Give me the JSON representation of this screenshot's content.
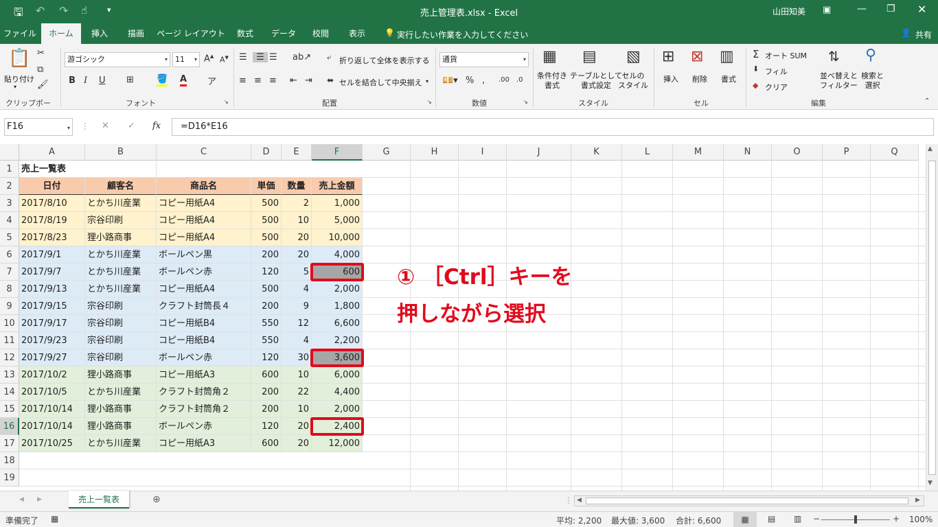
{
  "window": {
    "title": "売上管理表.xlsx - Excel",
    "user": "山田知美"
  },
  "tabs": [
    "ファイル",
    "ホーム",
    "挿入",
    "描画",
    "ページ レイアウト",
    "数式",
    "データ",
    "校閲",
    "表示"
  ],
  "tell_me": "実行したい作業を入力してください",
  "share": "共有",
  "ribbon": {
    "clipboard": {
      "paste": "貼り付け",
      "label": "クリップボード"
    },
    "font": {
      "name": "游ゴシック",
      "size": "11",
      "label": "フォント",
      "bold": "B",
      "italic": "I",
      "underline": "U"
    },
    "alignment": {
      "wrap": "折り返して全体を表示する",
      "merge": "セルを結合して中央揃え",
      "label": "配置"
    },
    "number": {
      "format": "通貨",
      "label": "数値"
    },
    "styles": {
      "cond": "条件付き\n書式",
      "table": "テーブルとして\n書式設定",
      "cell": "セルの\nスタイル",
      "label": "スタイル"
    },
    "cells": {
      "insert": "挿入",
      "delete": "削除",
      "format": "書式",
      "label": "セル"
    },
    "editing": {
      "autosum": "オート SUM",
      "fill": "フィル",
      "clear": "クリア",
      "sort": "並べ替えと\nフィルター",
      "find": "検索と\n選択",
      "label": "編集"
    }
  },
  "formula_bar": {
    "name_box": "F16",
    "fx": "fx",
    "formula": "=D16*E16"
  },
  "columns": [
    "A",
    "B",
    "C",
    "D",
    "E",
    "F",
    "G",
    "H",
    "I",
    "J",
    "K",
    "L",
    "M",
    "N",
    "O",
    "P",
    "Q"
  ],
  "rows": [
    "1",
    "2",
    "3",
    "4",
    "5",
    "6",
    "7",
    "8",
    "9",
    "10",
    "11",
    "12",
    "13",
    "14",
    "15",
    "16",
    "17",
    "18",
    "19"
  ],
  "sheet": {
    "title": "売上一覧表",
    "headers": [
      "日付",
      "顧客名",
      "商品名",
      "単価",
      "数量",
      "売上金額"
    ],
    "data": [
      [
        "2017/8/10",
        "とかち川産業",
        "コピー用紙A4",
        "500",
        "2",
        "1,000"
      ],
      [
        "2017/8/19",
        "宗谷印刷",
        "コピー用紙A4",
        "500",
        "10",
        "5,000"
      ],
      [
        "2017/8/23",
        "狸小路商事",
        "コピー用紙A4",
        "500",
        "20",
        "10,000"
      ],
      [
        "2017/9/1",
        "とかち川産業",
        "ボールペン黒",
        "200",
        "20",
        "4,000"
      ],
      [
        "2017/9/7",
        "とかち川産業",
        "ボールペン赤",
        "120",
        "5",
        "600"
      ],
      [
        "2017/9/13",
        "とかち川産業",
        "コピー用紙A4",
        "500",
        "4",
        "2,000"
      ],
      [
        "2017/9/15",
        "宗谷印刷",
        "クラフト封筒長４",
        "200",
        "9",
        "1,800"
      ],
      [
        "2017/9/17",
        "宗谷印刷",
        "コピー用紙B4",
        "550",
        "12",
        "6,600"
      ],
      [
        "2017/9/23",
        "宗谷印刷",
        "コピー用紙B4",
        "550",
        "4",
        "2,200"
      ],
      [
        "2017/9/27",
        "宗谷印刷",
        "ボールペン赤",
        "120",
        "30",
        "3,600"
      ],
      [
        "2017/10/2",
        "狸小路商事",
        "コピー用紙A3",
        "600",
        "10",
        "6,000"
      ],
      [
        "2017/10/5",
        "とかち川産業",
        "クラフト封筒角２",
        "200",
        "22",
        "4,400"
      ],
      [
        "2017/10/14",
        "狸小路商事",
        "クラフト封筒角２",
        "200",
        "10",
        "2,000"
      ],
      [
        "2017/10/14",
        "狸小路商事",
        "ボールペン赤",
        "120",
        "20",
        "2,400"
      ],
      [
        "2017/10/25",
        "とかち川産業",
        "コピー用紙A3",
        "600",
        "20",
        "12,000"
      ]
    ],
    "band_colors": [
      "#fff2cc",
      "#ddebf7",
      "#e2efda"
    ]
  },
  "annotation": {
    "line1": "① ［Ctrl］キーを",
    "line2": "押しながら選択",
    "color": "#e00b1c"
  },
  "sheet_tab": "売上一覧表",
  "status": {
    "ready": "準備完了",
    "average": "平均: 2,200",
    "max": "最大値: 3,600",
    "sum": "合計: 6,600",
    "zoom": "100%"
  },
  "accent": "#217346"
}
